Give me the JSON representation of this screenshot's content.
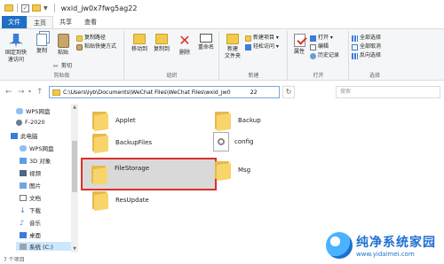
{
  "window": {
    "title": "wxid_jw0x7fwg5ag22"
  },
  "tabs": [
    "文件",
    "主页",
    "共享",
    "查看"
  ],
  "ribbon": {
    "clipboard": {
      "label": "剪贴板",
      "pin": "固定到快\n速访问",
      "copy": "复制",
      "paste": "粘贴",
      "copy_path": "复制路径",
      "paste_shortcut": "粘贴快捷方式",
      "cut": "剪切"
    },
    "organize": {
      "label": "组织",
      "move_to": "移动到",
      "copy_to": "复制到",
      "delete": "删除",
      "rename": "重命名"
    },
    "new": {
      "label": "新建",
      "new_folder": "新建\n文件夹",
      "new_item": "新建项目 ▾",
      "easy_access": "轻松访问 ▾"
    },
    "open": {
      "label": "打开",
      "properties": "属性",
      "open": "打开 ▾",
      "edit": "编辑",
      "history": "历史记录"
    },
    "select": {
      "label": "选择",
      "select_all": "全部选择",
      "select_none": "全部取消",
      "invert": "反向选择"
    }
  },
  "address": {
    "path": "C:\\Users\\lyb\\Documents\\WeChat Files\\WeChat Files\\wxid_jw0",
    "path_tail": "22",
    "search_placeholder": "搜索"
  },
  "nav_pane": [
    {
      "label": "WPS网盘",
      "icon": "cloud-icon"
    },
    {
      "label": "F-2020",
      "icon": "user-icon"
    },
    {
      "label": "此电脑",
      "icon": "computer-icon"
    },
    {
      "label": "WPS网盘",
      "icon": "cloud-icon"
    },
    {
      "label": "3D 对象",
      "icon": "cube-icon"
    },
    {
      "label": "视频",
      "icon": "video-icon"
    },
    {
      "label": "图片",
      "icon": "image-icon"
    },
    {
      "label": "文档",
      "icon": "document-icon"
    },
    {
      "label": "下载",
      "icon": "download-icon"
    },
    {
      "label": "音乐",
      "icon": "music-icon"
    },
    {
      "label": "桌面",
      "icon": "desktop-icon"
    },
    {
      "label": "系统 (C:)",
      "icon": "drive-icon"
    }
  ],
  "files": [
    {
      "name": "Applet",
      "type": "folder"
    },
    {
      "name": "Backup",
      "type": "folder"
    },
    {
      "name": "BackupFiles",
      "type": "folder"
    },
    {
      "name": "config",
      "type": "file"
    },
    {
      "name": "FileStorage",
      "type": "folder",
      "selected": true
    },
    {
      "name": "Msg",
      "type": "folder"
    },
    {
      "name": "ResUpdate",
      "type": "folder"
    }
  ],
  "status": {
    "count": "7 个项目"
  },
  "watermark": {
    "title": "纯净系统家园",
    "url": "www.yidaimei.com"
  },
  "colors": {
    "accent": "#1f6fc4",
    "highlight": "#d9302c",
    "folder": "#f7d56b"
  }
}
